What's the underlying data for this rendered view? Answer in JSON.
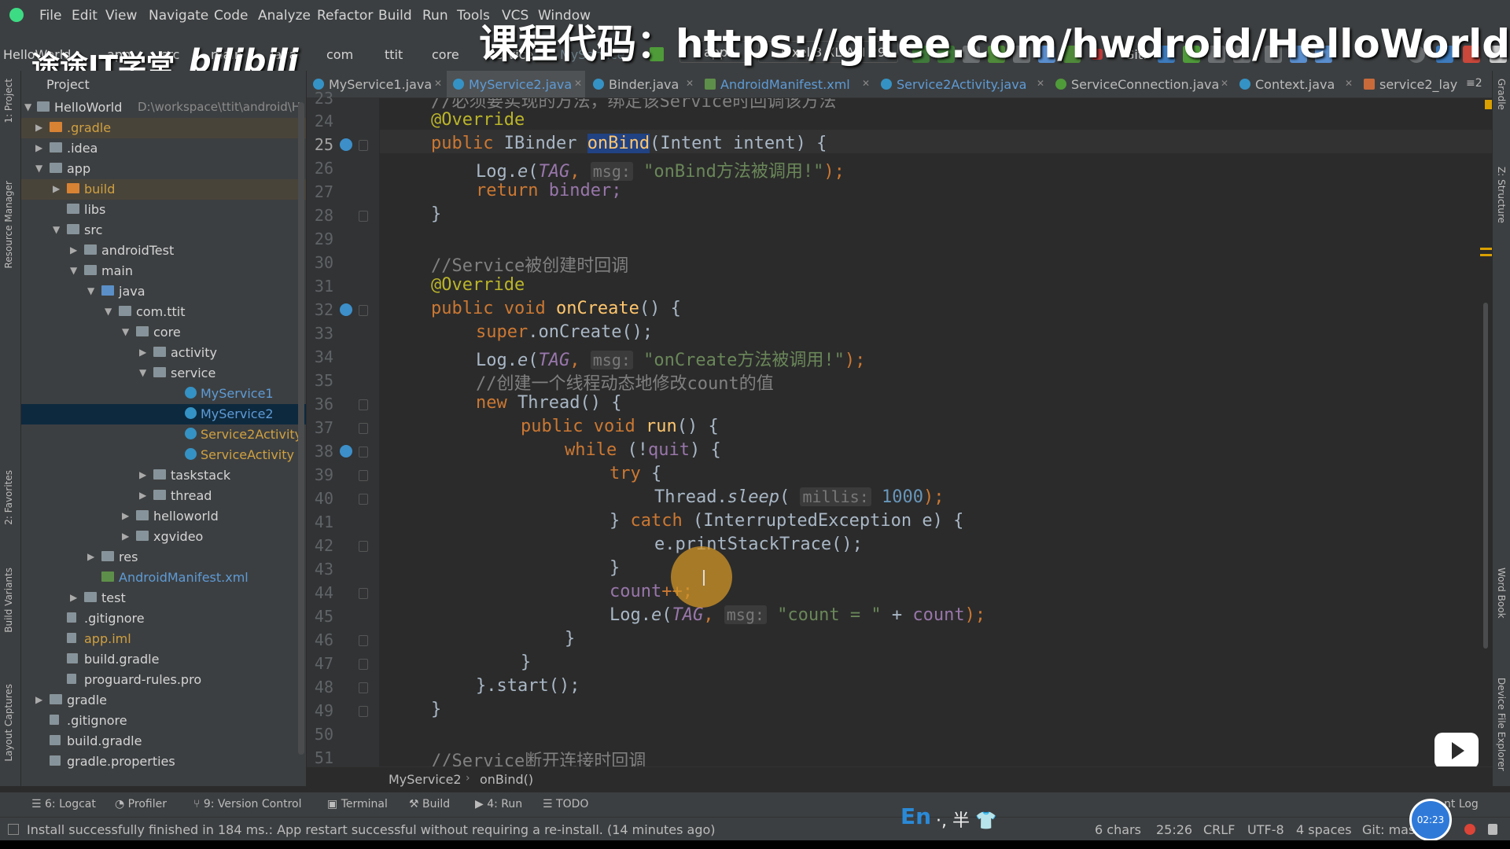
{
  "menubar": {
    "items": [
      "File",
      "Edit",
      "View",
      "Navigate",
      "Code",
      "Analyze",
      "Refactor",
      "Build",
      "Run",
      "Tools",
      "VCS",
      "Window"
    ]
  },
  "overlay": {
    "watermark": "课程代码：https://gitee.com/hwdroid/HelloWorld",
    "logo_text": "途途IT学堂",
    "bili_text": "bilibili"
  },
  "navbar": {
    "crumbs": [
      "HelloWorld",
      "app",
      "src",
      "main",
      "java",
      "com",
      "ttit",
      "core",
      "service",
      "MyService2"
    ],
    "run_config": "app",
    "device": "Pixel 3 XL API 29",
    "git_label": "Git:"
  },
  "project_pane": {
    "header": "Project",
    "tree": [
      {
        "label": "HelloWorld",
        "sub": "D:\\workspace\\ttit\\android\\H"
      },
      {
        "label": ".gradle"
      },
      {
        "label": ".idea"
      },
      {
        "label": "app"
      },
      {
        "label": "build"
      },
      {
        "label": "libs"
      },
      {
        "label": "src"
      },
      {
        "label": "androidTest"
      },
      {
        "label": "main"
      },
      {
        "label": "java"
      },
      {
        "label": "com.ttit"
      },
      {
        "label": "core"
      },
      {
        "label": "activity"
      },
      {
        "label": "service"
      },
      {
        "label": "MyService1"
      },
      {
        "label": "MyService2"
      },
      {
        "label": "Service2Activity"
      },
      {
        "label": "ServiceActivity"
      },
      {
        "label": "taskstack"
      },
      {
        "label": "thread"
      },
      {
        "label": "helloworld"
      },
      {
        "label": "xgvideo"
      },
      {
        "label": "res"
      },
      {
        "label": "AndroidManifest.xml"
      },
      {
        "label": "test"
      },
      {
        "label": ".gitignore"
      },
      {
        "label": "app.iml"
      },
      {
        "label": "build.gradle"
      },
      {
        "label": "proguard-rules.pro"
      },
      {
        "label": "gradle"
      },
      {
        "label": ".gitignore"
      },
      {
        "label": "build.gradle"
      },
      {
        "label": "gradle.properties"
      }
    ]
  },
  "tabs": [
    "MyService1.java",
    "MyService2.java",
    "Binder.java",
    "AndroidManifest.xml",
    "Service2Activity.java",
    "ServiceConnection.java",
    "Context.java",
    "service2_lay"
  ],
  "tab_overflow": "≡2",
  "editor": {
    "line_numbers": [
      "23",
      "24",
      "25",
      "26",
      "27",
      "28",
      "29",
      "30",
      "31",
      "32",
      "33",
      "34",
      "35",
      "36",
      "37",
      "38",
      "39",
      "40",
      "41",
      "42",
      "43",
      "44",
      "45",
      "46",
      "47",
      "48",
      "49",
      "50",
      "51"
    ]
  },
  "code": {
    "l23": "//必须要实现的方法，绑定该Service时回调该方法",
    "l24_ann": "@Override",
    "l25_kw": "public ",
    "l25_type": "IBinder ",
    "l25_fn": "onBind",
    "l25_rest": "(Intent intent) {",
    "l26_a": "Log.",
    "l26_b": "e",
    "l26_c": "(",
    "l26_tag": "TAG",
    "l26_d": ", ",
    "l26_hint": "msg:",
    "l26_str": "\"onBind方法被调用!\"",
    "l26_e": ");",
    "l27_kw": "return ",
    "l27_rest": "binder;",
    "l28": "}",
    "l30": "//Service被创建时回调",
    "l31_ann": "@Override",
    "l32_kw": "public void ",
    "l32_fn": "onCreate",
    "l32_rest": "() {",
    "l33_kw": "super",
    "l33_rest": ".onCreate();",
    "l34_a": "Log.",
    "l34_b": "e",
    "l34_c": "(",
    "l34_tag": "TAG",
    "l34_d": ", ",
    "l34_hint": "msg:",
    "l34_str": "\"onCreate方法被调用!\"",
    "l34_e": ");",
    "l35": "//创建一个线程动态地修改count的值",
    "l36_kw": "new ",
    "l36_rest": "Thread() {",
    "l37_kw": "public void ",
    "l37_fn": "run",
    "l37_rest": "() {",
    "l38_kw": "while ",
    "l38_a": "(!",
    "l38_fld": "quit",
    "l38_b": ") {",
    "l39_kw": "try ",
    "l39_rest": "{",
    "l40_a": "Thread.",
    "l40_b": "sleep",
    "l40_c": "( ",
    "l40_hint": "millis:",
    "l40_num": "1000",
    "l40_d": ");",
    "l41_a": "} ",
    "l41_kw": "catch ",
    "l41_rest": "(InterruptedException e) {",
    "l42": "e.printStackTrace();",
    "l43": "}",
    "l44_fld": "count",
    "l44_rest": "++;",
    "l45_a": "Log.",
    "l45_b": "e",
    "l45_c": "(",
    "l45_tag": "TAG",
    "l45_d": ", ",
    "l45_hint": "msg:",
    "l45_str": "\"count = \"",
    "l45_e": " + ",
    "l45_fld": "count",
    "l45_f": ");",
    "l46": "}",
    "l47": "}",
    "l48": "}.start();",
    "l49": "}",
    "l51": "//Service断开连接时回调"
  },
  "editor_breadcrumb": [
    "MyService2",
    "onBind()"
  ],
  "bottom_tools": [
    "6: Logcat",
    "Profiler",
    "9: Version Control",
    "Terminal",
    "Build",
    "4: Run",
    "TODO",
    "nt Log"
  ],
  "status": {
    "message": "Install successfully finished in 184 ms.: App restart successful without requiring a re-install. (14 minutes ago)",
    "ime": "En",
    "ime_rest": "·, 半",
    "chars": "6 chars",
    "position": "25:26",
    "line_sep": "CRLF",
    "encoding": "UTF-8",
    "indent": "4 spaces",
    "git": "Git: mas",
    "clock": "02:23"
  },
  "left_strip": [
    "1: Project",
    "Resource Manager",
    "2: Favorites",
    "Build Variants",
    "Layout Captures"
  ],
  "right_strip": [
    "Gradle",
    "Z: Structure",
    "Word Book",
    "Device File Explorer"
  ]
}
